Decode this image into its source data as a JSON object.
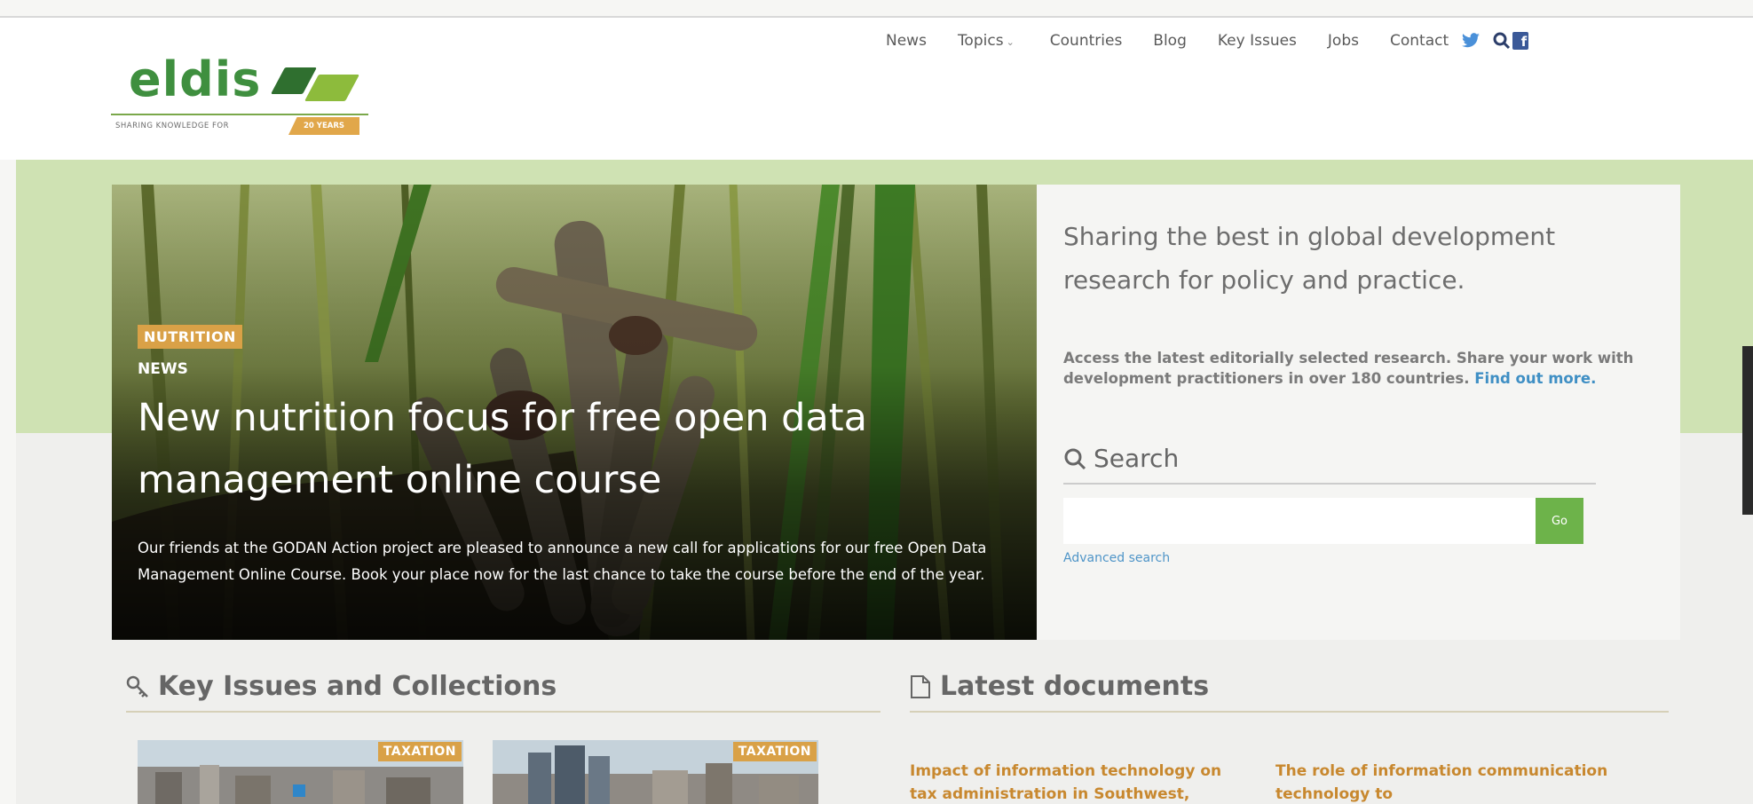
{
  "logo": {
    "wordmark": "eldis",
    "tagline": "SHARING KNOWLEDGE FOR",
    "badge": "20 YEARS"
  },
  "nav": {
    "items": [
      "News",
      "Topics",
      "Countries",
      "Blog",
      "Key Issues",
      "Jobs",
      "Contact"
    ],
    "icons": [
      "twitter-icon",
      "search-icon",
      "facebook-icon"
    ]
  },
  "hero": {
    "tag": "NUTRITION",
    "type": "NEWS",
    "title": "New nutrition focus for free open data management online course",
    "description": "Our friends at the GODAN Action project are pleased to announce a new call for applications for our free Open Data Management Online Course. Book your place now for the last chance to take the course before the end of the year."
  },
  "intro": {
    "tagline": "Sharing the best in global development research for policy and practice.",
    "description": "Access the latest editorially selected research. Share your work with development practitioners in over 180 countries.",
    "link": "Find out more."
  },
  "search": {
    "heading": "Search",
    "value": "",
    "button": "Go",
    "advanced": "Advanced search"
  },
  "key_issues": {
    "heading": "Key Issues and Collections",
    "cards": [
      {
        "tag": "TAXATION"
      },
      {
        "tag": "TAXATION"
      }
    ]
  },
  "latest_documents": {
    "heading": "Latest documents",
    "items": [
      "Impact of information technology on tax administration in Southwest,",
      "The role of information communication technology to"
    ]
  },
  "colors": {
    "brand_green": "#3f8f3f",
    "band_green": "#cfe2b3",
    "accent_orange": "#d9a147",
    "link_blue": "#3f8fc4",
    "go_green": "#6db34a"
  }
}
